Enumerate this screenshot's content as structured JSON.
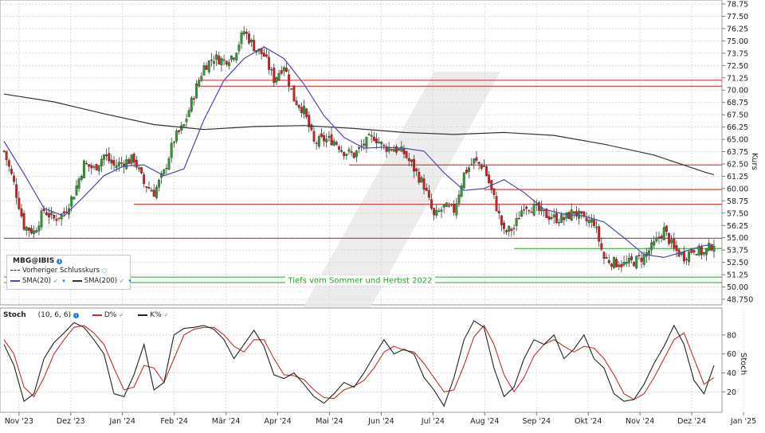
{
  "chart_data": [
    {
      "type": "candlestick",
      "symbol": "MBG@IBIS",
      "ylabel": "Kurs",
      "ylim": [
        48.5,
        78.75
      ],
      "y_ticks": [
        "78.75",
        "77.50",
        "76.25",
        "75.00",
        "73.75",
        "72.50",
        "71.25",
        "70.00",
        "68.75",
        "67.50",
        "66.25",
        "65.00",
        "63.75",
        "62.50",
        "61.25",
        "60.00",
        "58.75",
        "57.50",
        "56.25",
        "55.00",
        "53.75",
        "52.50",
        "51.25",
        "50.00",
        "48.750"
      ],
      "legend": {
        "title": "MBG@IBIS",
        "items": [
          {
            "name": "Vorheriger Schlusskurs",
            "color": "#222222",
            "style": "dashed"
          },
          {
            "name": "SMA(20)",
            "color": "#4a4ab0"
          },
          {
            "name": "SMA(200)",
            "color": "#333333"
          }
        ]
      },
      "colors": {
        "up": "#2e9b2e",
        "down": "#d42020",
        "sma20": "#4a4ab0",
        "sma200": "#333333",
        "resistance": "#d42020",
        "support": "#2e9b2e"
      },
      "x_axis_months": [
        "Nov '23",
        "Dez '23",
        "Jan '24",
        "Feb '24",
        "Mär '24",
        "Apr '24",
        "Mai '24",
        "Jun '24",
        "Jul '24",
        "Aug '24",
        "Sep '24",
        "Okt '24",
        "Nov '24",
        "Dez '24",
        "Jan '25"
      ],
      "close_path": [
        [
          0,
          63.8
        ],
        [
          4,
          60.5
        ],
        [
          8,
          56.2
        ],
        [
          12,
          55.6
        ],
        [
          16,
          57.8
        ],
        [
          20,
          56.9
        ],
        [
          24,
          57.5
        ],
        [
          28,
          59.5
        ],
        [
          32,
          62.5
        ],
        [
          36,
          62.0
        ],
        [
          40,
          63.4
        ],
        [
          44,
          62.3
        ],
        [
          48,
          62.7
        ],
        [
          52,
          63.0
        ],
        [
          56,
          60.5
        ],
        [
          60,
          59.6
        ],
        [
          64,
          61.6
        ],
        [
          68,
          65.0
        ],
        [
          72,
          66.4
        ],
        [
          76,
          69.6
        ],
        [
          80,
          72.4
        ],
        [
          84,
          73.3
        ],
        [
          88,
          73.0
        ],
        [
          92,
          73.6
        ],
        [
          96,
          76.0
        ],
        [
          100,
          74.4
        ],
        [
          104,
          73.5
        ],
        [
          108,
          71.1
        ],
        [
          112,
          72.6
        ],
        [
          116,
          69.1
        ],
        [
          120,
          67.9
        ],
        [
          124,
          64.6
        ],
        [
          128,
          65.0
        ],
        [
          132,
          64.9
        ],
        [
          136,
          63.8
        ],
        [
          140,
          63.4
        ],
        [
          144,
          64.5
        ],
        [
          148,
          65.3
        ],
        [
          152,
          64.2
        ],
        [
          156,
          64.1
        ],
        [
          160,
          63.6
        ],
        [
          164,
          62.0
        ],
        [
          168,
          60.3
        ],
        [
          172,
          57.1
        ],
        [
          176,
          58.1
        ],
        [
          180,
          57.8
        ],
        [
          184,
          61.5
        ],
        [
          188,
          62.8
        ],
        [
          192,
          62.2
        ],
        [
          196,
          59.0
        ],
        [
          200,
          55.5
        ],
        [
          204,
          56.0
        ],
        [
          208,
          58.4
        ],
        [
          212,
          58.0
        ],
        [
          216,
          57.4
        ],
        [
          220,
          57.0
        ],
        [
          224,
          56.9
        ],
        [
          228,
          57.7
        ],
        [
          232,
          56.7
        ],
        [
          236,
          56.6
        ],
        [
          240,
          52.9
        ],
        [
          244,
          52.5
        ],
        [
          248,
          52.3
        ],
        [
          252,
          52.6
        ],
        [
          256,
          53.1
        ],
        [
          260,
          54.3
        ],
        [
          264,
          55.8
        ],
        [
          268,
          53.8
        ],
        [
          272,
          53.1
        ],
        [
          276,
          53.9
        ],
        [
          280,
          53.4
        ],
        [
          284,
          54.5
        ]
      ],
      "sma20_path": [
        [
          0,
          64.8
        ],
        [
          8,
          61.5
        ],
        [
          16,
          58.0
        ],
        [
          24,
          57.2
        ],
        [
          32,
          59.2
        ],
        [
          40,
          61.3
        ],
        [
          48,
          62.3
        ],
        [
          56,
          62.4
        ],
        [
          64,
          61.3
        ],
        [
          72,
          62.0
        ],
        [
          80,
          67.0
        ],
        [
          88,
          71.0
        ],
        [
          96,
          73.2
        ],
        [
          104,
          74.4
        ],
        [
          112,
          73.2
        ],
        [
          120,
          70.6
        ],
        [
          128,
          67.4
        ],
        [
          136,
          65.2
        ],
        [
          144,
          64.1
        ],
        [
          152,
          64.2
        ],
        [
          160,
          64.1
        ],
        [
          168,
          63.8
        ],
        [
          176,
          61.6
        ],
        [
          184,
          59.8
        ],
        [
          192,
          60.0
        ],
        [
          200,
          60.9
        ],
        [
          208,
          59.6
        ],
        [
          216,
          57.9
        ],
        [
          224,
          57.4
        ],
        [
          232,
          57.2
        ],
        [
          240,
          56.6
        ],
        [
          248,
          55.0
        ],
        [
          256,
          53.3
        ],
        [
          264,
          53.0
        ],
        [
          272,
          53.6
        ],
        [
          280,
          54.2
        ],
        [
          284,
          54.3
        ]
      ],
      "sma200_path": [
        [
          0,
          69.6
        ],
        [
          20,
          68.8
        ],
        [
          40,
          67.6
        ],
        [
          60,
          66.5
        ],
        [
          80,
          66.0
        ],
        [
          100,
          66.3
        ],
        [
          120,
          66.4
        ],
        [
          140,
          66.1
        ],
        [
          160,
          65.7
        ],
        [
          180,
          65.5
        ],
        [
          200,
          65.7
        ],
        [
          220,
          65.4
        ],
        [
          240,
          64.5
        ],
        [
          260,
          63.4
        ],
        [
          280,
          61.7
        ],
        [
          284,
          61.4
        ]
      ],
      "horizontal_lines": [
        {
          "kind": "resistance",
          "value": 71.0,
          "from_day": 78
        },
        {
          "kind": "resistance",
          "value": 70.4,
          "from_day": 78
        },
        {
          "kind": "resistance",
          "value": 62.4,
          "from_day": 138
        },
        {
          "kind": "resistance",
          "value": 59.9,
          "from_day": 192
        },
        {
          "kind": "resistance",
          "value": 58.4,
          "from_day": 52
        },
        {
          "kind": "resistance",
          "value": 54.95,
          "from_day": 0
        },
        {
          "kind": "support",
          "value": 53.9,
          "from_day": 204
        },
        {
          "kind": "support",
          "value": 51.0,
          "from_day": 0
        },
        {
          "kind": "support",
          "value": 50.45,
          "from_day": 0
        }
      ],
      "annotation": "Tiefs vom Sommer und Herbst 2022"
    },
    {
      "type": "line",
      "indicator": "Stoch",
      "params": "(10, 6, 6)",
      "ylabel": "Stoch",
      "ylim": [
        0,
        100
      ],
      "y_ticks": [
        "80",
        "60",
        "40",
        "20"
      ],
      "series": [
        {
          "name": "D%",
          "color": "#c0302a"
        },
        {
          "name": "K%",
          "color": "#222222"
        }
      ],
      "k_path": [
        [
          0,
          70
        ],
        [
          4,
          48
        ],
        [
          8,
          10
        ],
        [
          12,
          18
        ],
        [
          16,
          55
        ],
        [
          20,
          72
        ],
        [
          24,
          82
        ],
        [
          28,
          93
        ],
        [
          32,
          88
        ],
        [
          36,
          75
        ],
        [
          40,
          60
        ],
        [
          44,
          18
        ],
        [
          48,
          15
        ],
        [
          52,
          38
        ],
        [
          56,
          70
        ],
        [
          60,
          22
        ],
        [
          64,
          30
        ],
        [
          68,
          80
        ],
        [
          72,
          87
        ],
        [
          76,
          88
        ],
        [
          80,
          90
        ],
        [
          84,
          86
        ],
        [
          88,
          75
        ],
        [
          92,
          55
        ],
        [
          96,
          70
        ],
        [
          100,
          85
        ],
        [
          104,
          68
        ],
        [
          108,
          38
        ],
        [
          112,
          34
        ],
        [
          116,
          40
        ],
        [
          120,
          28
        ],
        [
          124,
          15
        ],
        [
          128,
          8
        ],
        [
          132,
          18
        ],
        [
          136,
          30
        ],
        [
          140,
          25
        ],
        [
          144,
          40
        ],
        [
          148,
          58
        ],
        [
          152,
          75
        ],
        [
          156,
          60
        ],
        [
          160,
          65
        ],
        [
          164,
          60
        ],
        [
          168,
          35
        ],
        [
          172,
          22
        ],
        [
          176,
          5
        ],
        [
          180,
          35
        ],
        [
          184,
          75
        ],
        [
          188,
          95
        ],
        [
          192,
          88
        ],
        [
          196,
          45
        ],
        [
          200,
          15
        ],
        [
          204,
          25
        ],
        [
          208,
          55
        ],
        [
          212,
          75
        ],
        [
          216,
          70
        ],
        [
          220,
          80
        ],
        [
          224,
          55
        ],
        [
          228,
          65
        ],
        [
          232,
          80
        ],
        [
          236,
          55
        ],
        [
          240,
          45
        ],
        [
          244,
          18
        ],
        [
          248,
          10
        ],
        [
          252,
          12
        ],
        [
          256,
          28
        ],
        [
          260,
          50
        ],
        [
          264,
          68
        ],
        [
          268,
          90
        ],
        [
          272,
          70
        ],
        [
          276,
          32
        ],
        [
          280,
          18
        ],
        [
          284,
          48
        ]
      ],
      "d_path": [
        [
          0,
          75
        ],
        [
          4,
          60
        ],
        [
          8,
          25
        ],
        [
          12,
          15
        ],
        [
          16,
          35
        ],
        [
          20,
          60
        ],
        [
          24,
          75
        ],
        [
          28,
          88
        ],
        [
          32,
          90
        ],
        [
          36,
          82
        ],
        [
          40,
          70
        ],
        [
          44,
          45
        ],
        [
          48,
          22
        ],
        [
          52,
          25
        ],
        [
          56,
          48
        ],
        [
          60,
          45
        ],
        [
          64,
          30
        ],
        [
          68,
          55
        ],
        [
          72,
          80
        ],
        [
          76,
          86
        ],
        [
          80,
          88
        ],
        [
          84,
          88
        ],
        [
          88,
          80
        ],
        [
          92,
          68
        ],
        [
          96,
          62
        ],
        [
          100,
          75
        ],
        [
          104,
          75
        ],
        [
          108,
          55
        ],
        [
          112,
          38
        ],
        [
          116,
          37
        ],
        [
          120,
          33
        ],
        [
          124,
          22
        ],
        [
          128,
          14
        ],
        [
          132,
          13
        ],
        [
          136,
          22
        ],
        [
          140,
          26
        ],
        [
          144,
          32
        ],
        [
          148,
          45
        ],
        [
          152,
          62
        ],
        [
          156,
          68
        ],
        [
          160,
          64
        ],
        [
          164,
          62
        ],
        [
          168,
          50
        ],
        [
          172,
          35
        ],
        [
          176,
          20
        ],
        [
          180,
          22
        ],
        [
          184,
          48
        ],
        [
          188,
          78
        ],
        [
          192,
          90
        ],
        [
          196,
          70
        ],
        [
          200,
          38
        ],
        [
          204,
          20
        ],
        [
          208,
          35
        ],
        [
          212,
          58
        ],
        [
          216,
          70
        ],
        [
          220,
          75
        ],
        [
          224,
          68
        ],
        [
          228,
          62
        ],
        [
          232,
          68
        ],
        [
          236,
          66
        ],
        [
          240,
          55
        ],
        [
          244,
          38
        ],
        [
          248,
          18
        ],
        [
          252,
          12
        ],
        [
          256,
          18
        ],
        [
          260,
          35
        ],
        [
          264,
          55
        ],
        [
          268,
          75
        ],
        [
          272,
          82
        ],
        [
          276,
          55
        ],
        [
          280,
          28
        ],
        [
          284,
          35
        ]
      ]
    }
  ]
}
